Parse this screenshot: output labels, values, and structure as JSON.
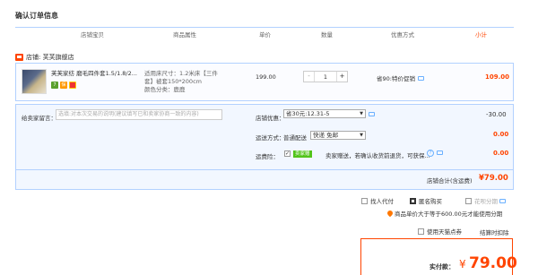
{
  "page_title": "确认订单信息",
  "table_headers": {
    "shop_item": "店铺宝贝",
    "attributes": "商品属性",
    "unit_price": "单价",
    "quantity": "数量",
    "promo": "优惠方式",
    "subtotal": "小计"
  },
  "shop": {
    "label": "店铺: 芙芙旗舰店"
  },
  "item": {
    "name_line1": "芙芙家纺 磨毛四件套1.5/1.8/2...",
    "name_line2": "",
    "badge1": "7",
    "badge2": "保",
    "badge3": "",
    "attr_line1": "适用床尺寸：1.2米床【三件",
    "attr_line2": "套】被套150*200cm",
    "attr_line3": "颜色分类：鹿鹿",
    "price": "199.00",
    "qty_minus": "-",
    "qty_value": "1",
    "qty_plus": "+",
    "promo": "省90:特价促销",
    "subtotal": "109.00"
  },
  "options": {
    "message_label": "给卖家留言：",
    "message_placeholder": "选填:对本次交易的说明(建议填写已和卖家协商一致的内容)",
    "shop_discount_label": "店铺优惠：",
    "shop_discount_value": "省30元:12.31-5",
    "shop_discount_amount": "-30.00",
    "shipping_label": "运送方式：",
    "shipping_type": "普通配送",
    "shipping_value": "快递 免邮",
    "shipping_amount": "0.00",
    "insurance_label": "运费险：",
    "insurance_check": "✓",
    "insurance_badge": "卖家赠",
    "insurance_text": "卖家赠送，若确认收货前退货，可获保...",
    "insurance_help": "?",
    "insurance_amount": "0.00",
    "total_label": "店铺合计(含运费)",
    "total_value": "¥79.00"
  },
  "checkout": {
    "proxy_pay": "找人代付",
    "anonymous": "匿名购买",
    "huabei": "花呗分期",
    "installment_note": "商品单价大于等于600.00元才能使用分期",
    "tmall_coupon": "使用天猫点券",
    "settle_deduct": "结算时扣除",
    "pay_label": "实付款：",
    "pay_yen": "¥",
    "pay_value": "79.00"
  },
  "colors": {
    "accent": "#ff4400",
    "border": "#b2d1ff",
    "panel": "#f2f7ff"
  }
}
